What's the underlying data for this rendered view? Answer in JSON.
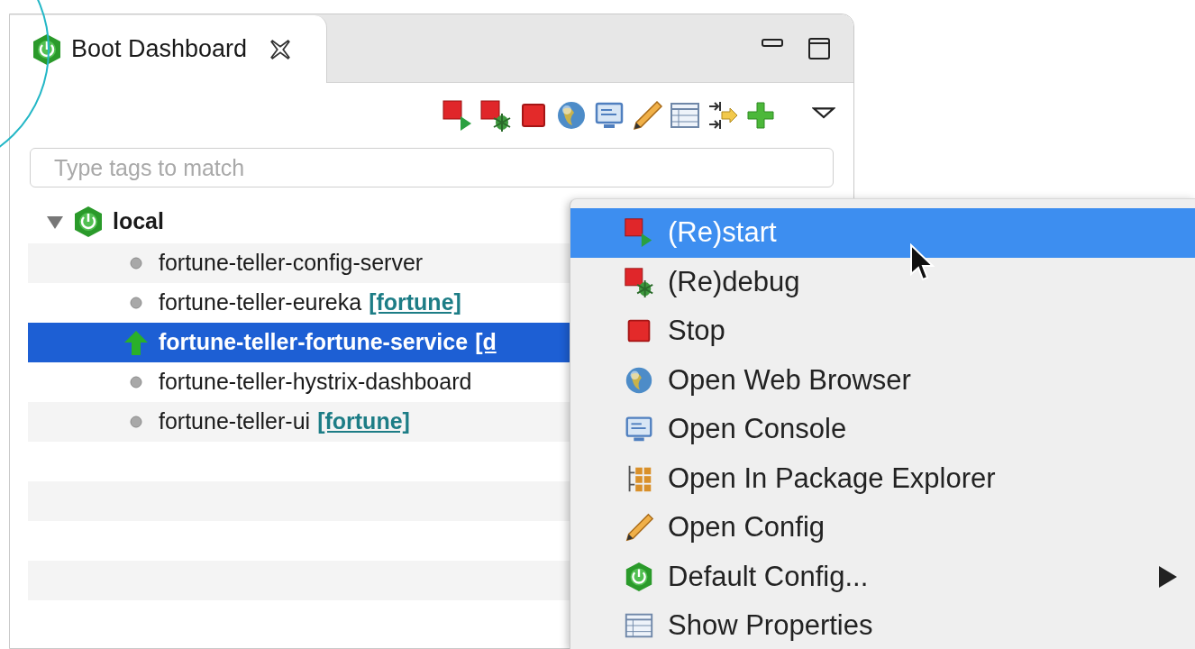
{
  "tab": {
    "title": "Boot Dashboard",
    "selected": true
  },
  "toolbar": [
    {
      "kind": "restart"
    },
    {
      "kind": "debug"
    },
    {
      "kind": "stop"
    },
    {
      "kind": "globe"
    },
    {
      "kind": "console"
    },
    {
      "kind": "pencil"
    },
    {
      "kind": "table"
    },
    {
      "kind": "link"
    },
    {
      "kind": "plus"
    }
  ],
  "search": {
    "placeholder": "Type tags to match"
  },
  "tree": {
    "label": "local",
    "expanded": true,
    "children": [
      {
        "name": "fortune-teller-config-server",
        "kind": "stopped",
        "selected": false
      },
      {
        "name": "fortune-teller-eureka",
        "tag": "[fortune]",
        "kind": "stopped",
        "selected": false
      },
      {
        "name": "fortune-teller-fortune-service",
        "tag": "[d",
        "kind": "running",
        "selected": true
      },
      {
        "name": "fortune-teller-hystrix-dashboard",
        "kind": "stopped",
        "selected": false
      },
      {
        "name": "fortune-teller-ui",
        "tag": "[fortune]",
        "kind": "stopped",
        "selected": false
      }
    ]
  },
  "context_menu": [
    {
      "label": "(Re)start",
      "kind": "restart",
      "selected": true,
      "submenu": false
    },
    {
      "label": "(Re)debug",
      "kind": "debug",
      "selected": false,
      "submenu": false
    },
    {
      "label": "Stop",
      "kind": "stop",
      "selected": false,
      "submenu": false
    },
    {
      "label": "Open Web Browser",
      "kind": "globe",
      "selected": false,
      "submenu": false
    },
    {
      "label": "Open Console",
      "kind": "console",
      "selected": false,
      "submenu": false
    },
    {
      "label": "Open In Package Explorer",
      "kind": "package",
      "selected": false,
      "submenu": false
    },
    {
      "label": "Open Config",
      "kind": "pencil",
      "selected": false,
      "submenu": false
    },
    {
      "label": "Default Config...",
      "kind": "boot",
      "selected": false,
      "submenu": true
    },
    {
      "label": "Show Properties",
      "kind": "table",
      "selected": false,
      "submenu": false
    }
  ]
}
